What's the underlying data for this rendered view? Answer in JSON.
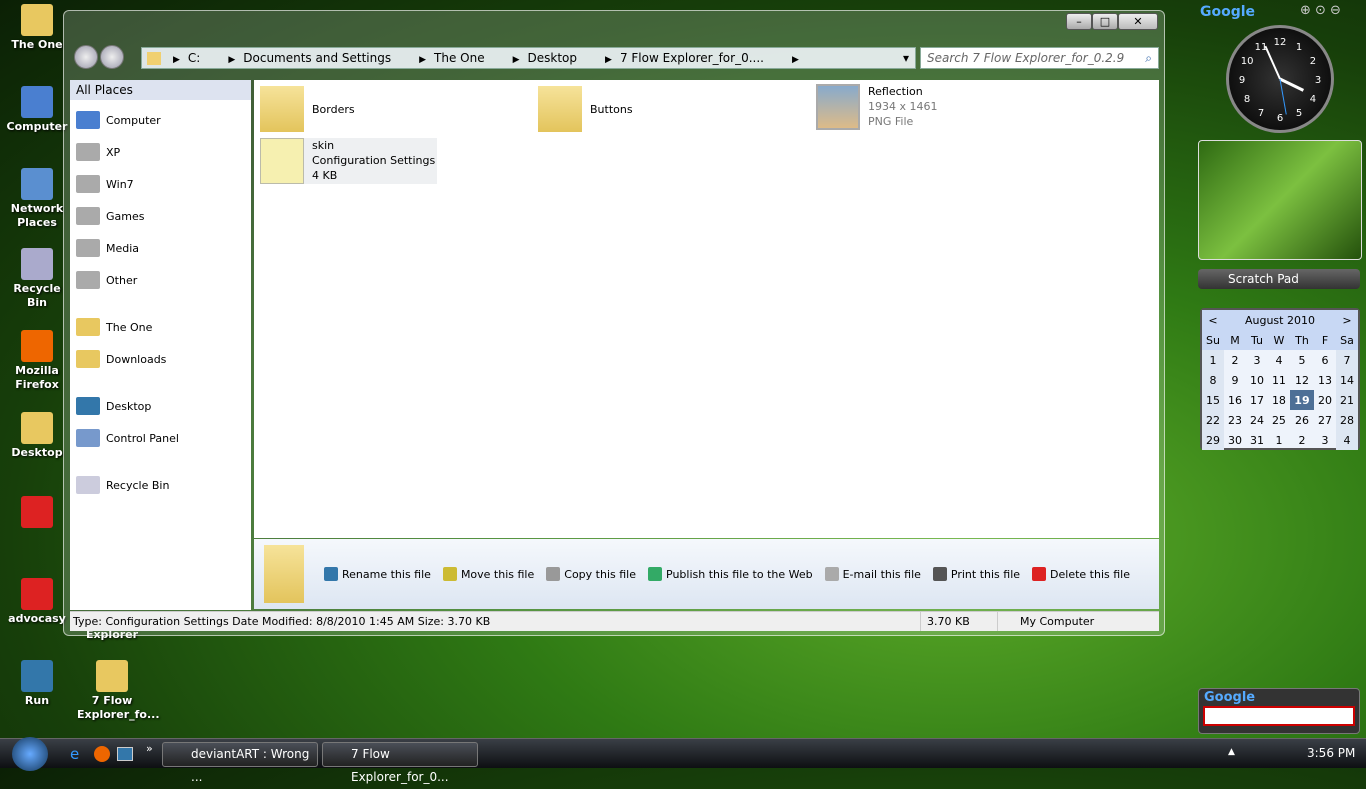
{
  "desktop": {
    "icons": [
      "The One",
      "Computer",
      "Network Places",
      "Recycle Bin",
      "Mozilla Firefox",
      "Desktop",
      "",
      "advocasy",
      "Run",
      "7 Flow Explorer_fo..."
    ],
    "partial_label": "Explorer"
  },
  "window": {
    "controls": [
      "minimize",
      "maximize",
      "close"
    ],
    "address": [
      "C:",
      "Documents and Settings",
      "The One",
      "Desktop",
      "7 Flow Explorer_for_0...."
    ],
    "search_placeholder": "Search 7 Flow Explorer_for_0.2.9",
    "sidebar": {
      "header": "All Places",
      "items": [
        "Computer",
        "XP",
        "Win7",
        "Games",
        "Media",
        "Other",
        "The One",
        "Downloads",
        "Desktop",
        "Control Panel",
        "Recycle Bin"
      ]
    },
    "files": [
      {
        "name": "Borders"
      },
      {
        "name": "Buttons"
      },
      {
        "name": "Reflection",
        "line2": "1934 x 1461",
        "line3": "PNG File"
      },
      {
        "name": "skin",
        "line2": "Configuration Settings",
        "line3": "4 KB"
      }
    ],
    "commands": [
      "Rename this file",
      "Move this file",
      "Copy this file",
      "Publish this file to the Web",
      "E-mail this file",
      "Print this file",
      "Delete this file"
    ],
    "status": {
      "info": "Type: Configuration Settings Date Modified: 8/8/2010 1:45 AM Size: 3.70 KB",
      "size": "3.70 KB",
      "zone": "My Computer"
    }
  },
  "gadgets": {
    "google_logo": "Google",
    "scratch_pad": "Scratch Pad",
    "calendar": {
      "month": "August 2010",
      "prev": "<",
      "next": ">",
      "days": [
        "Su",
        "M",
        "Tu",
        "W",
        "Th",
        "F",
        "Sa"
      ],
      "weeks": [
        [
          "1",
          "2",
          "3",
          "4",
          "5",
          "6",
          "7"
        ],
        [
          "8",
          "9",
          "10",
          "11",
          "12",
          "13",
          "14"
        ],
        [
          "15",
          "16",
          "17",
          "18",
          "19",
          "20",
          "21"
        ],
        [
          "22",
          "23",
          "24",
          "25",
          "26",
          "27",
          "28"
        ],
        [
          "29",
          "30",
          "31",
          "1",
          "2",
          "3",
          "4"
        ]
      ],
      "today": "19"
    },
    "clock_numbers": [
      "12",
      "1",
      "2",
      "3",
      "4",
      "5",
      "6",
      "7",
      "8",
      "9",
      "10",
      "11"
    ]
  },
  "taskbar": {
    "tasks": [
      "deviantART : Wrong ...",
      "7 Flow Explorer_for_0..."
    ],
    "overflow": "»",
    "clock": "3:56 PM"
  }
}
